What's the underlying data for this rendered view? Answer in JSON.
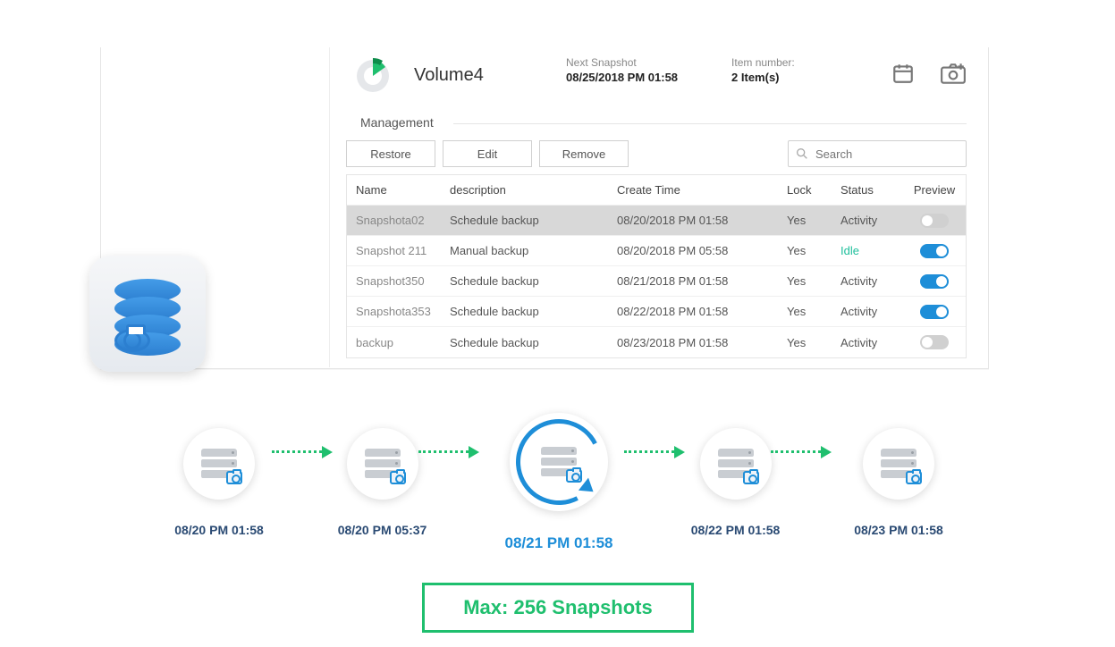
{
  "volume": {
    "title": "Volume4",
    "next_label": "Next Snapshot",
    "next_value": "08/25/2018 PM 01:58",
    "items_label": "Item number:",
    "items_value": "2 Item(s)"
  },
  "section": "Management",
  "buttons": {
    "restore": "Restore",
    "edit": "Edit",
    "remove": "Remove"
  },
  "search": {
    "placeholder": "Search"
  },
  "columns": {
    "name": "Name",
    "desc": "description",
    "time": "Create Time",
    "lock": "Lock",
    "status": "Status",
    "preview": "Preview"
  },
  "rows": [
    {
      "name": "Snapshota02",
      "desc": "Schedule backup",
      "time": "08/20/2018 PM 01:58",
      "lock": "Yes",
      "status": "Activity",
      "on": false,
      "sel": true
    },
    {
      "name": "Snapshot 211",
      "desc": "Manual backup",
      "time": "08/20/2018 PM 05:58",
      "lock": "Yes",
      "status": "Idle",
      "on": true,
      "idle": true
    },
    {
      "name": "Snapshot350",
      "desc": "Schedule backup",
      "time": "08/21/2018 PM 01:58",
      "lock": "Yes",
      "status": "Activity",
      "on": true
    },
    {
      "name": "Snapshota353",
      "desc": "Schedule backup",
      "time": "08/22/2018 PM 01:58",
      "lock": "Yes",
      "status": "Activity",
      "on": true
    },
    {
      "name": "backup",
      "desc": "Schedule backup",
      "time": "08/23/2018 PM 01:58",
      "lock": "Yes",
      "status": "Activity",
      "on": false
    }
  ],
  "timeline": [
    {
      "label": "08/20 PM 01:58"
    },
    {
      "label": "08/20 PM 05:37"
    },
    {
      "label": "08/21 PM 01:58",
      "big": true
    },
    {
      "label": "08/22 PM 01:58"
    },
    {
      "label": "08/23 PM 01:58"
    }
  ],
  "max": "Max: 256 Snapshots"
}
